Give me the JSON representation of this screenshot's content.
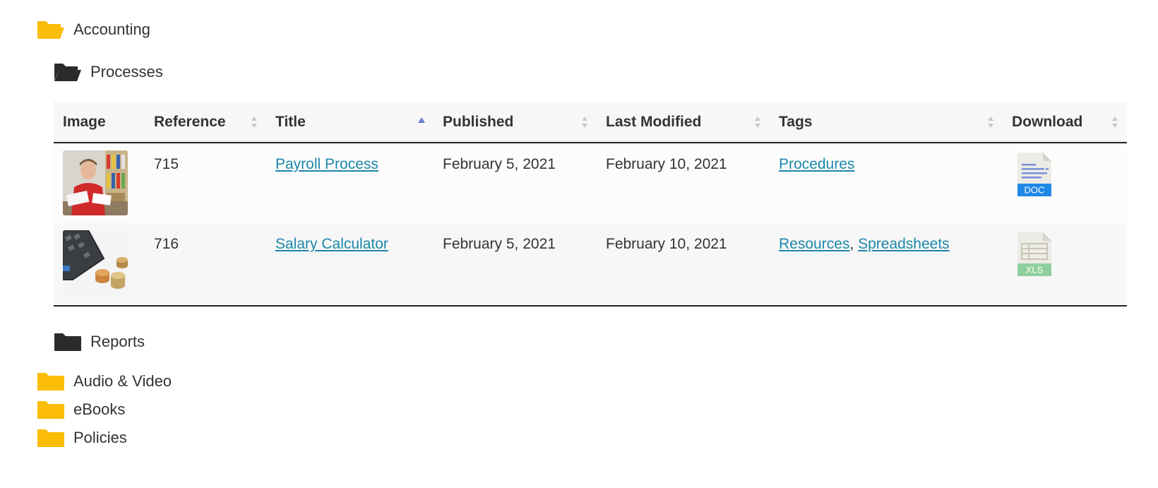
{
  "tree": {
    "accounting": {
      "label": "Accounting",
      "icon": "folder-open-icon",
      "color": "#fbbd08"
    },
    "processes": {
      "label": "Processes",
      "icon": "folder-open-icon",
      "color": "#2b2b2b"
    },
    "reports": {
      "label": "Reports",
      "icon": "folder-icon",
      "color": "#2b2b2b"
    },
    "audio_video": {
      "label": "Audio & Video",
      "icon": "folder-icon",
      "color": "#fbbd08"
    },
    "ebooks": {
      "label": "eBooks",
      "icon": "folder-icon",
      "color": "#fbbd08"
    },
    "policies": {
      "label": "Policies",
      "icon": "folder-icon",
      "color": "#fbbd08"
    }
  },
  "table": {
    "columns": [
      {
        "label": "Image",
        "sortable": false,
        "sort": "none"
      },
      {
        "label": "Reference",
        "sortable": true,
        "sort": "none"
      },
      {
        "label": "Title",
        "sortable": true,
        "sort": "asc"
      },
      {
        "label": "Published",
        "sortable": true,
        "sort": "none"
      },
      {
        "label": "Last Modified",
        "sortable": true,
        "sort": "none"
      },
      {
        "label": "Tags",
        "sortable": true,
        "sort": "none"
      },
      {
        "label": "Download",
        "sortable": true,
        "sort": "none"
      }
    ],
    "rows": [
      {
        "image": "person-with-papers-thumbnail",
        "reference": "715",
        "title": "Payroll Process",
        "published": "February 5, 2021",
        "last_modified": "February 10, 2021",
        "tags": [
          "Procedures"
        ],
        "tag_separator": "",
        "download": {
          "type": "DOC",
          "icon": "doc-file-icon",
          "color": "#1e88e5"
        }
      },
      {
        "image": "calculator-and-coins-thumbnail",
        "reference": "716",
        "title": "Salary Calculator",
        "published": "February 5, 2021",
        "last_modified": "February 10, 2021",
        "tags": [
          "Resources",
          "Spreadsheets"
        ],
        "tag_separator": ",",
        "download": {
          "type": "XLS",
          "icon": "xls-file-icon",
          "color": "#8fcf9d"
        }
      }
    ]
  },
  "colors": {
    "link": "#1b87a8",
    "sort_active": "#6b7fd7",
    "sort_inactive": "#c8c8c8"
  }
}
